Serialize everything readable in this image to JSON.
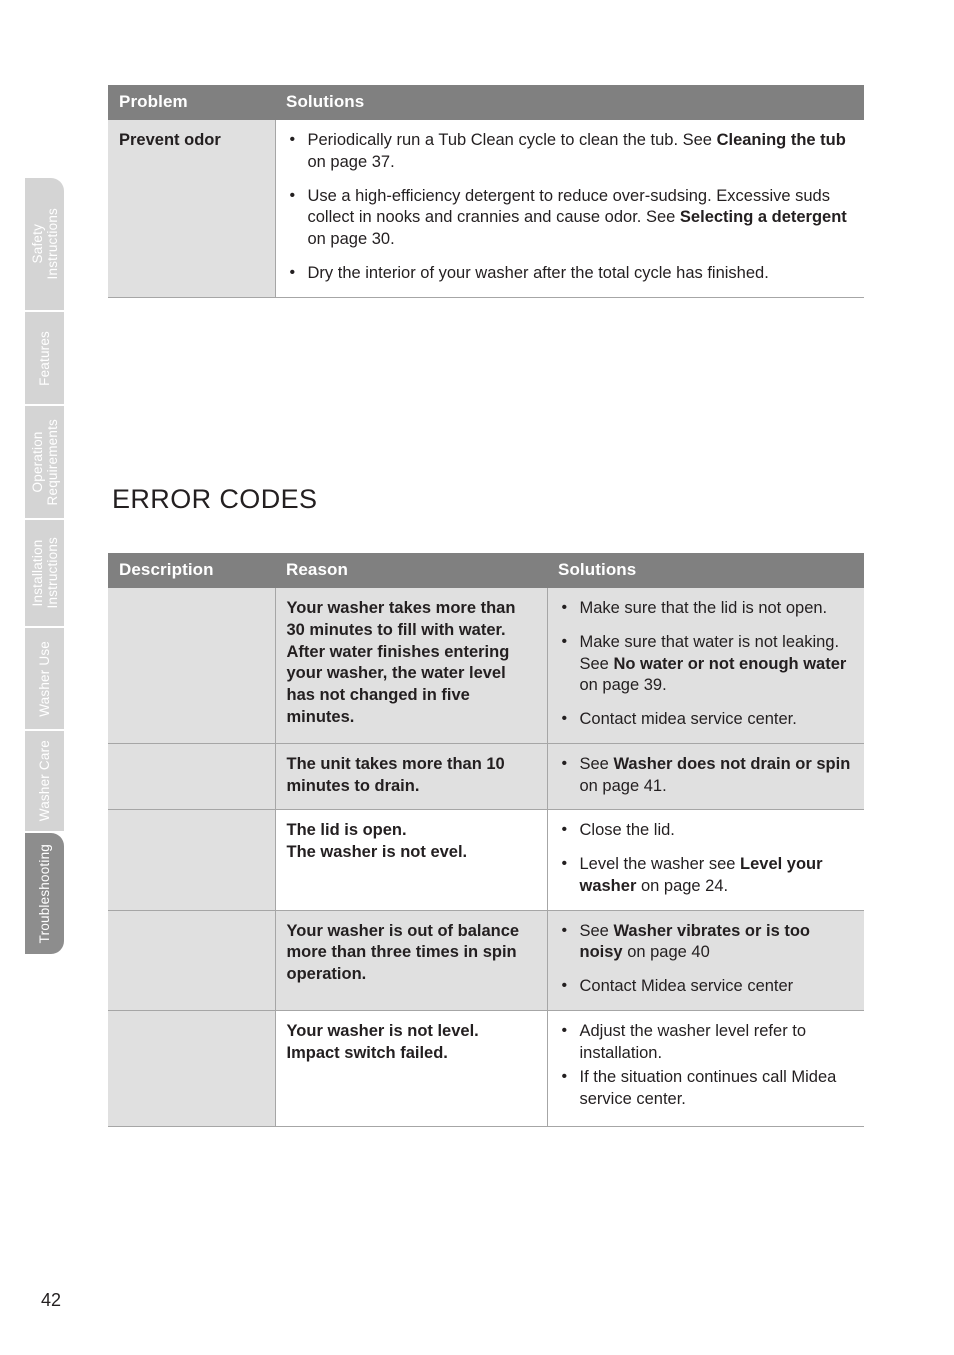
{
  "page": {
    "number": "42",
    "section_heading": "ERROR CODES"
  },
  "side_tabs": [
    {
      "label": "Safety\nInstructions",
      "active": false
    },
    {
      "label": "Features",
      "active": false
    },
    {
      "label": "Operation\nRequirements",
      "active": false
    },
    {
      "label": "Installation\nInstructions",
      "active": false
    },
    {
      "label": "Washer Use",
      "active": false
    },
    {
      "label": "Washer Care",
      "active": false
    },
    {
      "label": "Troubleshooting",
      "active": true
    }
  ],
  "troubleshooting_table": {
    "headers": [
      "Problem",
      "Solutions"
    ],
    "rows": [
      {
        "problem": "Prevent odor",
        "solutions": [
          [
            {
              "t": "Periodically run a Tub Clean cycle to clean the tub. See ",
              "b": false
            },
            {
              "t": "Cleaning the tub",
              "b": true
            },
            {
              "t": " on page 37.",
              "b": false
            }
          ],
          [
            {
              "t": "Use a high-efficiency detergent to reduce over-sudsing. Excessive suds collect in nooks and crannies and cause odor. See ",
              "b": false
            },
            {
              "t": "Selecting a detergent",
              "b": true
            },
            {
              "t": " on page 30.",
              "b": false
            }
          ],
          [
            {
              "t": "Dry the interior of your washer after the total cycle has finished.",
              "b": false
            }
          ]
        ]
      }
    ]
  },
  "error_codes_table": {
    "headers": [
      "Description",
      "Reason",
      "Solutions"
    ],
    "rows": [
      {
        "shaded": true,
        "tight": false,
        "description": "",
        "reason": "Your washer takes more than 30 minutes to fill with water. After water finishes entering your washer, the water level has not changed in five minutes.",
        "solutions": [
          [
            {
              "t": "Make sure that the lid is not open.",
              "b": false
            }
          ],
          [
            {
              "t": "Make sure that water is not leaking. See ",
              "b": false
            },
            {
              "t": "No water or not enough water",
              "b": true
            },
            {
              "t": " on page 39.",
              "b": false
            }
          ],
          [
            {
              "t": "Contact midea service center.",
              "b": false
            }
          ]
        ]
      },
      {
        "shaded": true,
        "tight": false,
        "description": "",
        "reason": "The unit takes more than 10 minutes to drain.",
        "solutions": [
          [
            {
              "t": "See ",
              "b": false
            },
            {
              "t": "Washer does not drain or spin",
              "b": true
            },
            {
              "t": " on page 41.",
              "b": false
            }
          ]
        ]
      },
      {
        "shaded": false,
        "tight": false,
        "description": "",
        "reason": "The lid is open.\nThe washer is not evel.",
        "solutions": [
          [
            {
              "t": "Close the lid.",
              "b": false
            }
          ],
          [
            {
              "t": "Level the washer see ",
              "b": false
            },
            {
              "t": "Level your washer",
              "b": true
            },
            {
              "t": " on page 24.",
              "b": false
            }
          ]
        ]
      },
      {
        "shaded": true,
        "tight": false,
        "description": "",
        "reason": "Your washer is out of balance more than three times in spin operation.",
        "solutions": [
          [
            {
              "t": "See ",
              "b": false
            },
            {
              "t": "Washer vibrates or is too noisy",
              "b": true
            },
            {
              "t": " on page 40",
              "b": false
            }
          ],
          [
            {
              "t": "Contact Midea service center",
              "b": false
            }
          ]
        ]
      },
      {
        "shaded": false,
        "tight": true,
        "description": "",
        "reason": "Your washer is not level.\nImpact switch failed.",
        "solutions": [
          [
            {
              "t": "Adjust the washer level refer to installation.",
              "b": false
            }
          ],
          [
            {
              "t": "If the situation continues call Midea service center.",
              "b": false
            }
          ]
        ]
      }
    ]
  },
  "colors": {
    "header_gray": "#808080",
    "row_shade": "#e0e0e0",
    "tab_inactive": "#d4d4d4",
    "tab_active": "#8d8d8d",
    "border": "#a6a6a6",
    "text": "#231f20"
  }
}
